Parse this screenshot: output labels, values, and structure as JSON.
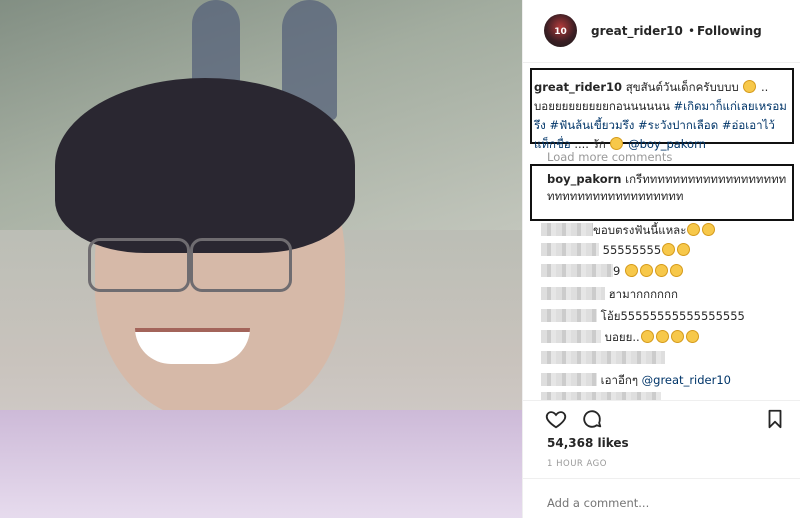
{
  "header": {
    "avatar_text": "10",
    "username": "great_rider10",
    "separator": "•",
    "follow_status": "Following"
  },
  "caption": {
    "username": "great_rider10",
    "text_1": "สุขสันต์วันเด็กครับบบบ",
    "text_2": "..",
    "text_3": "บอยยยยยยยยยกอนนนนนน",
    "hashtags": [
      "#เกิดมาก็แก่เลยเหรอมรึง",
      "#ฟันล้นเขี้ยวมรึง",
      "#ระวังปากเลือด",
      "#อ่อเอาไว้แท็กชื่อ"
    ],
    "text_4": "....",
    "text_5": "รัก",
    "mention": "@boy_pakorn"
  },
  "load_more": "Load more comments",
  "highlight_comment": {
    "username": "boy_pakorn",
    "text": "เกรีททททททททททททททททททททททททททททททททททททท"
  },
  "comments": [
    {
      "text": "ขอบตรงฟันนี้แหละ",
      "emoji_count": 2
    },
    {
      "text": "55555555",
      "emoji_count": 2
    },
    {
      "text": "9",
      "emoji_count": 4
    },
    {
      "text": "ฮามากกกกกก",
      "emoji_count": 0
    },
    {
      "text": "โอ้ย55555555555555555",
      "emoji_count": 0
    },
    {
      "text": "บอยย..",
      "emoji_count": 4
    },
    {
      "text": "",
      "emoji_count": 0
    },
    {
      "text": "เอาอีกๆ",
      "mention": "@great_rider10"
    }
  ],
  "actions": {
    "like_icon": "heart-icon",
    "comment_icon": "comment-icon",
    "save_icon": "bookmark-icon"
  },
  "likes": "54,368 likes",
  "timestamp": "1 HOUR AGO",
  "add_comment_placeholder": "Add a comment...",
  "colors": {
    "link": "#003569",
    "muted": "#999999",
    "border": "#efefef"
  }
}
